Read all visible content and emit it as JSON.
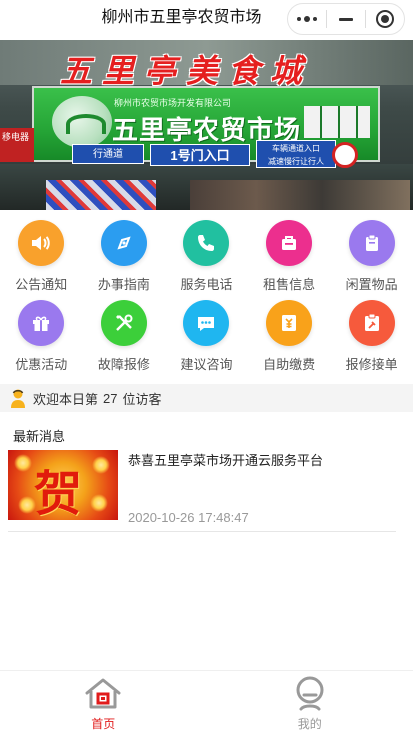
{
  "header": {
    "title": "柳州市五里亭农贸市场"
  },
  "banner": {
    "big_sign": "五里亭美食城",
    "market_sign_sub": "柳州市农贸市场开发有限公司",
    "market_sign": "五里亭农贸市场",
    "entry_sign": "1号门入口",
    "left_sign": "行通道",
    "side_sign_line1": "车辆通道入口",
    "side_sign_line2": "减速慢行让行人",
    "red_store_sign": "移电器"
  },
  "grid": [
    {
      "label": "公告通知",
      "icon": "speaker-icon",
      "color": "#f9a12c"
    },
    {
      "label": "办事指南",
      "icon": "compass-icon",
      "color": "#2b9df0"
    },
    {
      "label": "服务电话",
      "icon": "phone-icon",
      "color": "#21c0a0"
    },
    {
      "label": "租售信息",
      "icon": "shop-icon",
      "color": "#ec2f8e"
    },
    {
      "label": "闲置物品",
      "icon": "item-icon",
      "color": "#9a79ee"
    },
    {
      "label": "优惠活动",
      "icon": "gift-icon",
      "color": "#9a79ee"
    },
    {
      "label": "故障报修",
      "icon": "tools-icon",
      "color": "#3ccf3a"
    },
    {
      "label": "建议咨询",
      "icon": "chat-icon",
      "color": "#1fb6f0"
    },
    {
      "label": "自助缴费",
      "icon": "payment-icon",
      "color": "#f9a21a"
    },
    {
      "label": "报修接单",
      "icon": "repair-order-icon",
      "color": "#f65a3c"
    }
  ],
  "visitor": {
    "prefix": "欢迎本日第",
    "count": "27",
    "suffix": "位访客"
  },
  "news": {
    "section_title": "最新消息",
    "items": [
      {
        "headline": "恭喜五里亭菜市场开通云服务平台",
        "time": "2020-10-26 17:48:47",
        "thumb_text": "贺"
      }
    ]
  },
  "tabbar": {
    "home_label": "首页",
    "mine_label": "我的",
    "active_color": "#e11b1b"
  }
}
